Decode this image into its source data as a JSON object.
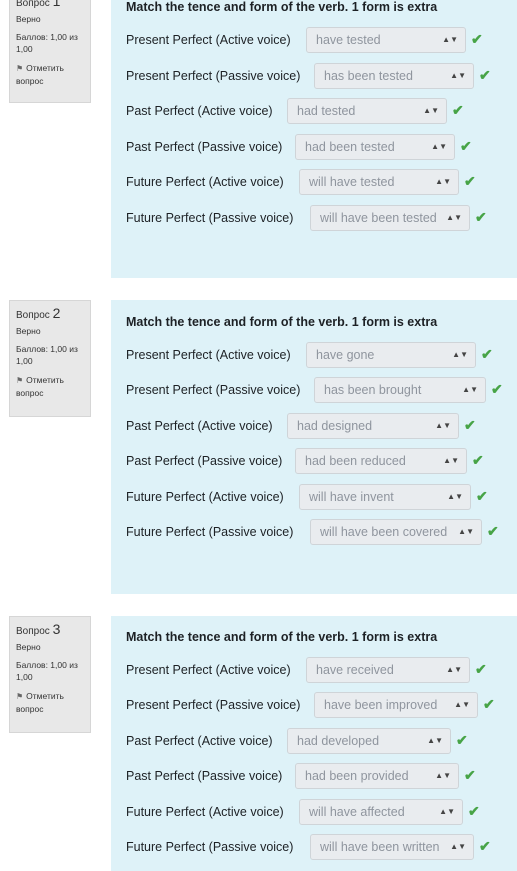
{
  "questions": [
    {
      "prefix": "Вопрос",
      "number": "1",
      "status": "Верно",
      "score": "Баллов: 1,00 из 1,00",
      "flag_label": "Отметить вопрос",
      "text": "Match the tence and form of the verb. 1 form is extra",
      "rows": [
        {
          "label": "Present Perfect (Active voice)",
          "value": "have tested"
        },
        {
          "label": "Present Perfect (Passive voice)",
          "value": "has been tested"
        },
        {
          "label": "Past Perfect (Active voice)",
          "value": "had tested"
        },
        {
          "label": "Past Perfect (Passive voice)",
          "value": "had been tested"
        },
        {
          "label": "Future Perfect (Active voice)",
          "value": "will have tested"
        },
        {
          "label": "Future  Perfect (Passive voice)",
          "value": "will have been tested"
        }
      ]
    },
    {
      "prefix": "Вопрос",
      "number": "2",
      "status": "Верно",
      "score": "Баллов: 1,00 из 1,00",
      "flag_label": "Отметить вопрос",
      "text": "Match the tence and form of the verb. 1 form is extra",
      "rows": [
        {
          "label": "Present Perfect (Active voice)",
          "value": "have gone"
        },
        {
          "label": "Present Perfect (Passive voice)",
          "value": "has been brought"
        },
        {
          "label": "Past Perfect (Active voice)",
          "value": "had designed"
        },
        {
          "label": "Past Perfect (Passive voice)",
          "value": "had been reduced"
        },
        {
          "label": "Future Perfect (Active voice)",
          "value": "will have invent"
        },
        {
          "label": "Future  Perfect (Passive voice)",
          "value": "will have been covered"
        }
      ]
    },
    {
      "prefix": "Вопрос",
      "number": "3",
      "status": "Верно",
      "score": "Баллов: 1,00 из 1,00",
      "flag_label": "Отметить вопрос",
      "text": "Match the tence and form of the verb. 1 form is extra",
      "rows": [
        {
          "label": "Present Perfect (Active voice)",
          "value": "have received"
        },
        {
          "label": "Present Perfect (Passive voice)",
          "value": "have been improved"
        },
        {
          "label": "Past Perfect (Active voice)",
          "value": "had developed"
        },
        {
          "label": "Past Perfect (Passive voice)",
          "value": "had been provided"
        },
        {
          "label": "Future Perfect (Active voice)",
          "value": "will have affected"
        },
        {
          "label": "Future  Perfect (Passive voice)",
          "value": "will have been written"
        }
      ]
    }
  ],
  "icons": {
    "dropdown": "sort-arrows-icon",
    "correct": "checkmark-icon",
    "flag": "flag-icon"
  },
  "colors": {
    "panel": "#def2f8",
    "info_box": "#e8e8e8",
    "correct": "#47a447",
    "select_bg": "#e9ecef"
  }
}
